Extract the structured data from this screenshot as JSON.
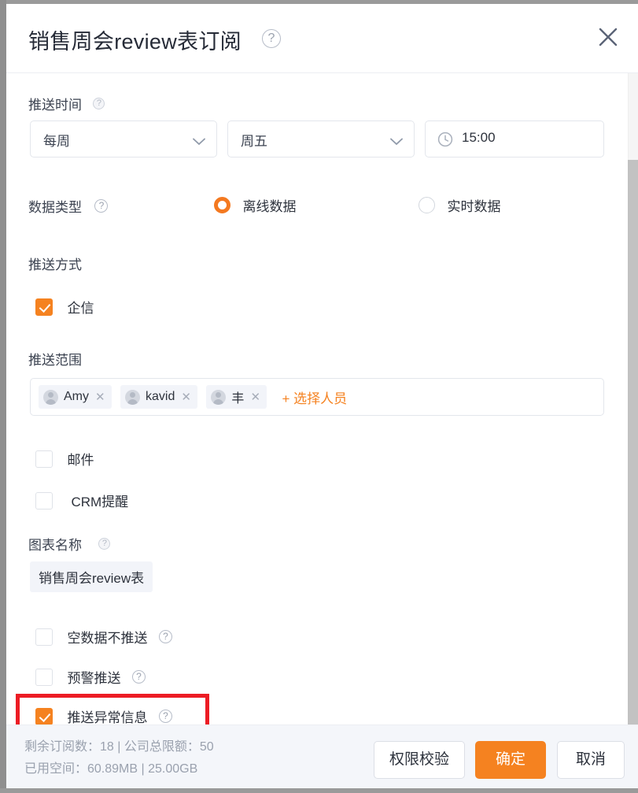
{
  "dialog": {
    "title": "销售周会review表订阅",
    "title_help_icon": "question-circle-icon",
    "close_icon": "close-icon"
  },
  "form": {
    "push_time": {
      "label": "推送时间",
      "help_icon": "question-circle-icon",
      "frequency_value": "每周",
      "frequency_chevron": "chevron-down-icon",
      "weekday_value": "周五",
      "weekday_chevron": "chevron-down-icon",
      "time_value": "15:00",
      "time_icon": "clock-icon"
    },
    "data_type": {
      "label": "数据类型",
      "help_icon": "question-circle-icon",
      "options": [
        {
          "label": "离线数据",
          "selected": true
        },
        {
          "label": "实时数据",
          "selected": false
        }
      ]
    },
    "push_method": {
      "label": "推送方式",
      "qixin": {
        "label": "企信",
        "checked": true
      },
      "email": {
        "label": "邮件",
        "checked": false
      },
      "crm": {
        "label": "CRM提醒",
        "checked": false
      }
    },
    "push_scope": {
      "label": "推送范围",
      "people": [
        {
          "name": "Amy",
          "avatar_icon": "user-avatar-icon",
          "remove_icon": "close-small-icon"
        },
        {
          "name": "kavid",
          "avatar_icon": "user-avatar-icon",
          "remove_icon": "close-small-icon"
        },
        {
          "name": "丰",
          "avatar_icon": "user-avatar-icon",
          "remove_icon": "close-small-icon"
        }
      ],
      "add_label": "+ 选择人员"
    },
    "chart_name": {
      "label": "图表名称",
      "help_icon": "question-circle-icon",
      "value": "销售周会review表"
    },
    "extra_options": [
      {
        "label": "空数据不推送",
        "checked": false,
        "help_icon": "question-circle-icon"
      },
      {
        "label": "预警推送",
        "checked": false,
        "help_icon": "question-circle-icon"
      },
      {
        "label": "推送异常信息",
        "checked": true,
        "help_icon": "question-circle-icon"
      }
    ]
  },
  "footer": {
    "info_line1": "剩余订阅数：18 | 公司总限额：50",
    "info_line2": "已用空间：60.89MB | 25.00GB",
    "buttons": {
      "permission": "权限校验",
      "confirm": "确定",
      "cancel": "取消"
    }
  },
  "colors": {
    "accent": "#f58220",
    "annotation": "#ec1c24",
    "text": "#2d323c",
    "muted": "#9aa1ae"
  }
}
